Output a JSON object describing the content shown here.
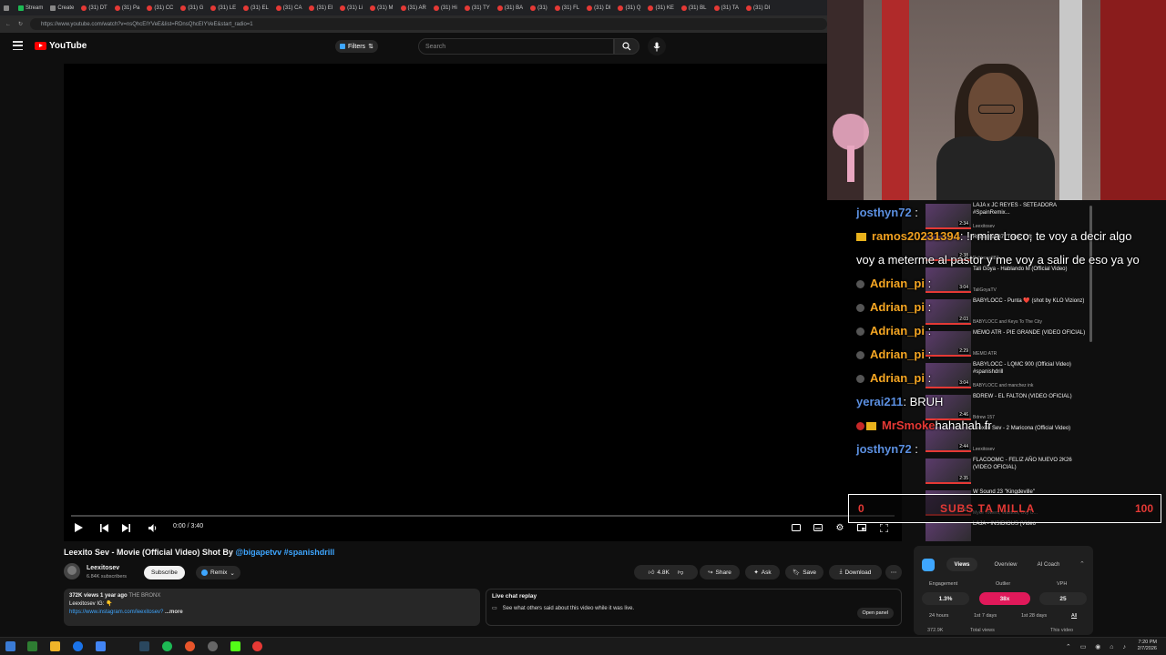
{
  "browser": {
    "tabs": [
      {
        "label": "",
        "icon": "gray"
      },
      {
        "label": "Stream",
        "icon": "green"
      },
      {
        "label": "Create",
        "icon": "gray"
      },
      {
        "label": "(31) DT",
        "icon": "red"
      },
      {
        "label": "(31) Pa",
        "icon": "red"
      },
      {
        "label": "(31) CC",
        "icon": "red"
      },
      {
        "label": "(31) G",
        "icon": "red"
      },
      {
        "label": "(31) LE",
        "icon": "red"
      },
      {
        "label": "(31) EL",
        "icon": "red"
      },
      {
        "label": "(31) CA",
        "icon": "red"
      },
      {
        "label": "(31) El",
        "icon": "red"
      },
      {
        "label": "(31) Li",
        "icon": "red"
      },
      {
        "label": "(31) M",
        "icon": "red"
      },
      {
        "label": "(31) AR",
        "icon": "red"
      },
      {
        "label": "(31) Hi",
        "icon": "red"
      },
      {
        "label": "(31) TY",
        "icon": "red"
      },
      {
        "label": "(31) BA",
        "icon": "red"
      },
      {
        "label": "(31) ",
        "icon": "red"
      },
      {
        "label": "(31) FL",
        "icon": "red"
      },
      {
        "label": "(31) DI",
        "icon": "red"
      },
      {
        "label": "(31) Q",
        "icon": "red"
      },
      {
        "label": "(31) KE",
        "icon": "red"
      },
      {
        "label": "(31) BL",
        "icon": "red"
      },
      {
        "label": "(31) TA",
        "icon": "red"
      },
      {
        "label": "(31) DI",
        "icon": "red"
      }
    ],
    "url": "https://www.youtube.com/watch?v=nsQhcEIYVeE&list=RDnsQhcEIYVeE&start_radio=1"
  },
  "header": {
    "logo": "YouTube",
    "filters_label": "Filters",
    "search_placeholder": "Search"
  },
  "player": {
    "time": "0:00 / 3:40",
    "progress": 0.0
  },
  "video": {
    "title": "Leexito Sev - Movie (Official Video) Shot By",
    "title_tags": "@bigapetvv #spanishdrill",
    "channel": "Leexitosev",
    "subscribers": "6.84K subscribers",
    "subscribe_label": "Subscribe",
    "remix_label": "Remix",
    "like_count": "4.8K",
    "share_label": "Share",
    "ask_label": "Ask",
    "save_label": "Save",
    "download_label": "Download",
    "desc_stats": "372K views  1 year ago",
    "desc_loc": "THE BRONX",
    "desc_line": "Leexitosev IG: 👇",
    "desc_link": "https://www.instagram.com/leexitosev?",
    "desc_more": "...more",
    "livechat_title": "Live chat replay",
    "livechat_text": "See what others said about this video while it was live.",
    "open_panel": "Open panel"
  },
  "playlist": [
    {
      "title": "LAJA x JC REYES - SETEADORA #SpainRemix...",
      "channel": "Leexitosev",
      "duration": "2:34"
    },
    {
      "title": "Rubirosa887 \"Triple 3\" ft",
      "channel": "Rubirosa887",
      "duration": "2:38"
    },
    {
      "title": "Tali Goya - Hablando M (Official Video)",
      "channel": "TaliGoyaTV",
      "duration": "3:04"
    },
    {
      "title": "BABYLOCC - Punta ❤️ (shot by KLO Vizionz)",
      "channel": "BABYLOCC and Keys To The City",
      "duration": "2:03"
    },
    {
      "title": "MEMO ATR - PIE GRANDE (VIDEO OFICIAL)",
      "channel": "MEMO ATR",
      "duration": "2:29"
    },
    {
      "title": "BABYLOCC - LQMC 900 (Official Video) #spanishdrill",
      "channel": "BABYLOCC and manchez ink",
      "duration": "3:04"
    },
    {
      "title": "BDREW - EL FALTON (VIDEO OFICIAL)",
      "channel": "Bdrew 157",
      "duration": "2:46"
    },
    {
      "title": "Leexito Sev - 2 Maricona (Official Video)",
      "channel": "Leexitosev",
      "duration": "2:44"
    },
    {
      "title": "FLACOOMC - FELIZ AÑO NUEVO 2K26 (VIDEO OFICIAL)",
      "channel": "",
      "duration": "2:35"
    },
    {
      "title": "W Sound 23 \"Kingdeville\"",
      "channel": "Myke Towers, Wastool, Ovy O...",
      "duration": "3:11"
    },
    {
      "title": "LAJA - INSIDIOUS (Video",
      "channel": "",
      "duration": ""
    }
  ],
  "chat": [
    {
      "user": "josthyn72",
      "text": "",
      "color": "#5b8fe0",
      "badge": ""
    },
    {
      "user": "ramos20231394",
      "text": ": !r mira Loco, te voy a decir algo",
      "color": "#f0a020",
      "badge": "crown"
    },
    {
      "user": "",
      "text": "voy a meterme al pastor y me voy a salir de eso ya yo",
      "color": "#ffffff",
      "badge": ""
    },
    {
      "user": "Adrian_pi",
      "text": "",
      "color": "#f5a623",
      "badge": "dot"
    },
    {
      "user": "Adrian_pi",
      "text": "",
      "color": "#f5a623",
      "badge": "dot"
    },
    {
      "user": "Adrian_pi",
      "text": "",
      "color": "#f5a623",
      "badge": "dot"
    },
    {
      "user": "Adrian_pi",
      "text": "",
      "color": "#f5a623",
      "badge": "dot"
    },
    {
      "user": "Adrian_pi",
      "text": "",
      "color": "#f5a623",
      "badge": "dot"
    },
    {
      "user": "yerai211",
      "text": ": BRUH",
      "color": "#5b8fe0",
      "badge": ""
    },
    {
      "user": "MrSmoke",
      "text": "hahahah fr",
      "color": "#e53935",
      "badge": "reddot-crown"
    },
    {
      "user": "josthyn72",
      "text": "",
      "color": "#5b8fe0",
      "badge": ""
    }
  ],
  "subgoal": {
    "current": "0",
    "label": "SUBS TA MILLA",
    "target": "100"
  },
  "analytics": {
    "tabs": [
      "Views",
      "Overview",
      "AI Coach"
    ],
    "labels": [
      "Engagement",
      "Outlier",
      "VPH"
    ],
    "values": [
      "1.3%",
      "38x",
      "25"
    ],
    "periods": [
      "24 hours",
      "1st 7 days",
      "1st 28 days",
      "All"
    ],
    "bottom_left": "372.9K",
    "bottom_mid": "Total views",
    "bottom_right": "This video"
  },
  "taskbar": {
    "time": "7:20 PM",
    "date": "2/7/2026"
  },
  "colors": {
    "yt_red": "#ff0000",
    "link_blue": "#3ea6ff",
    "outlier_pink": "#e0195a"
  }
}
